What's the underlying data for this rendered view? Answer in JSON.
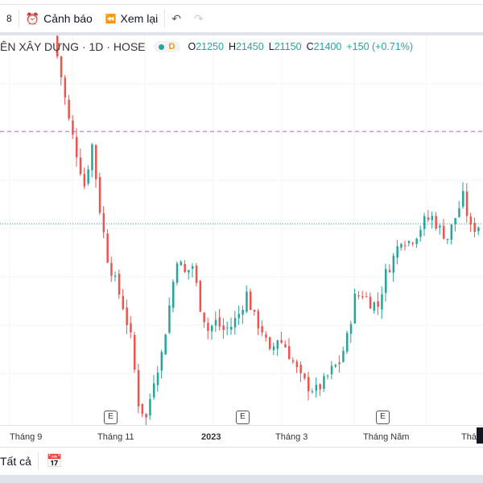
{
  "toolbar": {
    "alert_label": "Cảnh báo",
    "replay_label": "Xem lại"
  },
  "legend": {
    "symbol": "ÊN XÂY DỰNG · 1D · HOSE",
    "badge": "D",
    "open": "21250",
    "high": "21450",
    "low": "21150",
    "close": "21400",
    "change": "+150 (+0.71%)",
    "o": "O",
    "h": "H",
    "l": "L",
    "c": "C"
  },
  "time_axis": [
    "Tháng 9",
    "Tháng 11",
    "2023",
    "Tháng 3",
    "Tháng Năm",
    "Thá"
  ],
  "earnings_marker": "E",
  "bottom": {
    "range_label": "Tất cả"
  },
  "chart_data": {
    "type": "candlestick",
    "closes": [
      28450,
      26950,
      25300,
      24100,
      22900,
      24400,
      22000,
      20200,
      19300,
      18400,
      17200,
      14800,
      14200,
      15700,
      16600,
      18400,
      20200,
      19600,
      19900,
      18400,
      17500,
      17800,
      17500,
      17650,
      18100,
      18850,
      17950,
      17500,
      16600,
      17200,
      16900,
      16300,
      15700,
      15400,
      15250,
      15550,
      16000,
      16300,
      17200,
      18700,
      18850,
      18550,
      18400,
      19600,
      20200,
      20950,
      20800,
      21100,
      21550,
      21700,
      21250,
      20950,
      21700,
      22450,
      21250,
      21400
    ],
    "alert_level": 24900,
    "last_price_level": 21460,
    "colors": {
      "up": "#26a69a",
      "down": "#ef5350",
      "alert": "#ce93d8"
    }
  }
}
